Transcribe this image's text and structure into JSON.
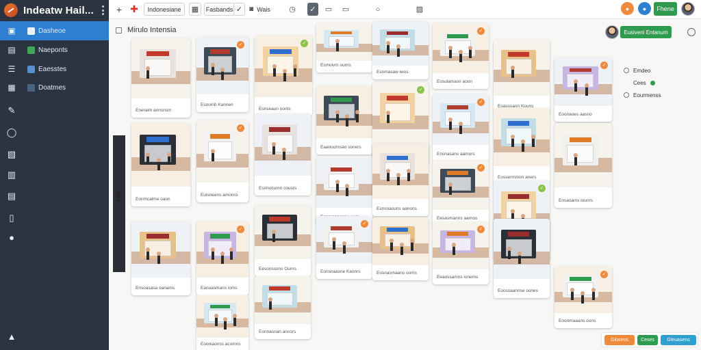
{
  "app": {
    "title": "Indeatw Hail...",
    "accent": "#2e9b4f",
    "sidebar_active": "#2f7fd0"
  },
  "sidebar": {
    "items": [
      {
        "label": "Dasheoe",
        "icon": "store-icon"
      },
      {
        "label": "Naeponts",
        "icon": "box-icon"
      },
      {
        "label": "Eaesstes",
        "icon": "list-icon"
      },
      {
        "label": "Doatmes",
        "icon": "calendar-icon"
      }
    ],
    "icons": [
      "tag-icon",
      "circle-icon",
      "building-icon",
      "grid-icon",
      "layers-icon",
      "door-icon",
      "person-icon",
      "footer-icon"
    ]
  },
  "toolbar": {
    "dropdown_label": "Indonesiane",
    "filter_label": "Fasbands",
    "view_label": "Wais",
    "primary_button": "Fhene",
    "icons": [
      "plus-icon",
      "add-red-icon",
      "grid-icon",
      "check-icon",
      "camera-icon",
      "clock-icon",
      "check-box-icon",
      "folder-icon",
      "window-icon",
      "circle-icon",
      "image-icon",
      "orange-badge-icon",
      "blue-badge-icon"
    ]
  },
  "header": {
    "title": "Mirulo Intensia",
    "action_button": "Eusiveni Entanum"
  },
  "filters": [
    {
      "label": "Emdeo"
    },
    {
      "label": "Cees",
      "active": true
    },
    {
      "label": "Eourmenss"
    }
  ],
  "side_label": "cto",
  "cards": [
    {
      "caption": "Eneraim annsnsm"
    },
    {
      "caption": "Esnoinb Kannen"
    },
    {
      "caption": "Esnseaun oonts"
    },
    {
      "caption": "Esmoivm ounrs"
    },
    {
      "caption": "Esnmasaw iwos"
    },
    {
      "caption": "Eosulamasn aoon"
    },
    {
      "caption": "Eoasssaon Kouns"
    },
    {
      "caption": "Eoonaoes aasno"
    },
    {
      "caption": "Eonmcalme oaon"
    },
    {
      "caption": "Euisneens amonro"
    },
    {
      "caption": "Esnnocumn cousrs"
    },
    {
      "caption": "Eaanuumsao soners"
    },
    {
      "caption": "Eoossaamn Keanns"
    },
    {
      "caption": "Ensnasans aamors"
    },
    {
      "caption": "Eossermmon aners"
    },
    {
      "caption": "Eosaoains iounrs"
    },
    {
      "caption": "Ensoasasa oanams"
    },
    {
      "caption": "Eanuasmans ioms"
    },
    {
      "caption": "Eesonssons Ounrs"
    },
    {
      "caption": "Eonmannnane ours"
    },
    {
      "caption": "Esnsnaouns aanons"
    },
    {
      "caption": "Eesasmanns aarnos"
    },
    {
      "caption": "Eosaomoers oeoms"
    },
    {
      "caption": "Eooniaonss acomns"
    },
    {
      "caption": "Eonnasnan ancors"
    },
    {
      "caption": "Eonsnaasne Kaonrs"
    },
    {
      "caption": "Eosnasmaans ooms"
    },
    {
      "caption": "Eeaossamns ionems"
    },
    {
      "caption": "Eoossaannse oones"
    },
    {
      "caption": "Eoonmaaans ouns"
    }
  ],
  "actions": {
    "primary": "Gloseos",
    "secondary": "Ceses",
    "tertiary": "Gleuasens"
  }
}
